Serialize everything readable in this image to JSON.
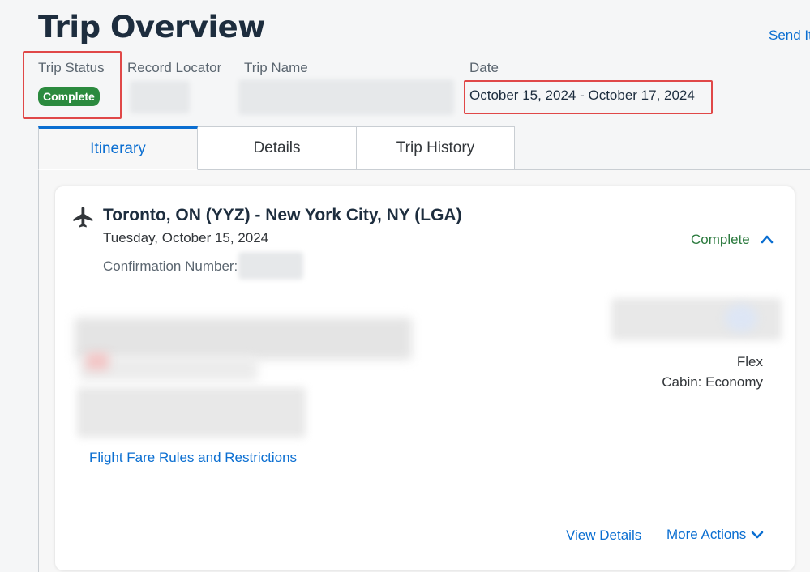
{
  "header": {
    "title": "Trip Overview",
    "send_link": "Send It"
  },
  "meta": {
    "status_label": "Trip Status",
    "status_value": "Complete",
    "locator_label": "Record Locator",
    "trip_name_label": "Trip Name",
    "date_label": "Date",
    "date_value": "October 15, 2024 - October 17, 2024"
  },
  "tabs": [
    {
      "label": "Itinerary",
      "active": true
    },
    {
      "label": "Details",
      "active": false
    },
    {
      "label": "Trip History",
      "active": false
    }
  ],
  "segment": {
    "icon": "airplane-icon",
    "route": "Toronto, ON (YYZ) - New York City, NY (LGA)",
    "date": "Tuesday, October 15, 2024",
    "confirmation_label": "Confirmation Number:",
    "status": "Complete",
    "fare_type": "Flex",
    "cabin": "Cabin: Economy",
    "fare_rules_link": "Flight Fare Rules and Restrictions",
    "view_details": "View Details",
    "more_actions": "More Actions"
  },
  "colors": {
    "accent": "#0a6ed1",
    "status_green": "#2b8a3e",
    "highlight_red": "#e04848"
  }
}
